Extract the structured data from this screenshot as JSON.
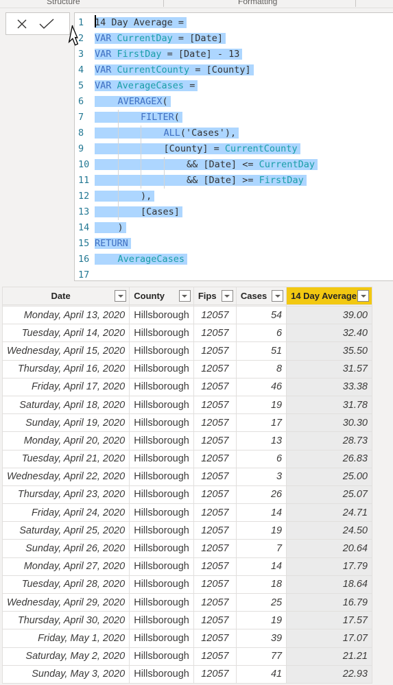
{
  "ribbon": {
    "groups": [
      "Structure",
      "Formatting"
    ]
  },
  "commit": {
    "cancel_icon": "close-icon",
    "commit_icon": "checkmark-icon"
  },
  "editor": {
    "lines": [
      {
        "n": "1",
        "indent": 0,
        "tokens": [
          {
            "t": "14 Day Average =",
            "c": "plain"
          }
        ]
      },
      {
        "n": "2",
        "indent": 0,
        "tokens": [
          {
            "t": "VAR ",
            "c": "kw"
          },
          {
            "t": "CurrentDay",
            "c": "var"
          },
          {
            "t": " = [Date]",
            "c": "plain"
          }
        ]
      },
      {
        "n": "3",
        "indent": 0,
        "tokens": [
          {
            "t": "VAR ",
            "c": "kw"
          },
          {
            "t": "FirstDay",
            "c": "var"
          },
          {
            "t": " = [Date] - 13",
            "c": "plain"
          }
        ]
      },
      {
        "n": "4",
        "indent": 0,
        "tokens": [
          {
            "t": "VAR ",
            "c": "kw"
          },
          {
            "t": "CurrentCounty",
            "c": "var"
          },
          {
            "t": " = [County]",
            "c": "plain"
          }
        ]
      },
      {
        "n": "5",
        "indent": 0,
        "tokens": [
          {
            "t": "VAR ",
            "c": "kw"
          },
          {
            "t": "AverageCases",
            "c": "var"
          },
          {
            "t": " =",
            "c": "plain"
          }
        ]
      },
      {
        "n": "6",
        "indent": 1,
        "tokens": [
          {
            "t": "AVERAGEX",
            "c": "kw"
          },
          {
            "t": "(",
            "c": "plain"
          }
        ]
      },
      {
        "n": "7",
        "indent": 2,
        "tokens": [
          {
            "t": "FILTER",
            "c": "kw"
          },
          {
            "t": "(",
            "c": "plain"
          }
        ]
      },
      {
        "n": "8",
        "indent": 3,
        "tokens": [
          {
            "t": "ALL",
            "c": "kw"
          },
          {
            "t": "('Cases'),",
            "c": "plain"
          }
        ]
      },
      {
        "n": "9",
        "indent": 3,
        "tokens": [
          {
            "t": "[County] = ",
            "c": "plain"
          },
          {
            "t": "CurrentCounty",
            "c": "var"
          }
        ]
      },
      {
        "n": "10",
        "indent": 4,
        "tokens": [
          {
            "t": "&& [Date] <= ",
            "c": "plain"
          },
          {
            "t": "CurrentDay",
            "c": "var"
          }
        ]
      },
      {
        "n": "11",
        "indent": 4,
        "tokens": [
          {
            "t": "&& [Date] >= ",
            "c": "plain"
          },
          {
            "t": "FirstDay",
            "c": "var"
          }
        ]
      },
      {
        "n": "12",
        "indent": 2,
        "tokens": [
          {
            "t": "),",
            "c": "plain"
          }
        ]
      },
      {
        "n": "13",
        "indent": 2,
        "tokens": [
          {
            "t": "[Cases]",
            "c": "plain"
          }
        ]
      },
      {
        "n": "14",
        "indent": 1,
        "tokens": [
          {
            "t": ")",
            "c": "plain"
          }
        ]
      },
      {
        "n": "15",
        "indent": 0,
        "tokens": [
          {
            "t": "RETURN",
            "c": "kw"
          }
        ]
      },
      {
        "n": "16",
        "indent": 1,
        "tokens": [
          {
            "t": "AverageCases",
            "c": "var"
          }
        ]
      },
      {
        "n": "17",
        "indent": 0,
        "tokens": []
      }
    ]
  },
  "table": {
    "columns": [
      {
        "label": "Date",
        "key": "date"
      },
      {
        "label": "County",
        "key": "county"
      },
      {
        "label": "Fips",
        "key": "fips"
      },
      {
        "label": "Cases",
        "key": "cases"
      },
      {
        "label": "14 Day Average",
        "key": "avg",
        "active": true
      }
    ],
    "active_color": "#F2C811",
    "rows": [
      {
        "date": "Monday, April 13, 2020",
        "county": "Hillsborough",
        "fips": "12057",
        "cases": "54",
        "avg": "39.00"
      },
      {
        "date": "Tuesday, April 14, 2020",
        "county": "Hillsborough",
        "fips": "12057",
        "cases": "6",
        "avg": "32.40"
      },
      {
        "date": "Wednesday, April 15, 2020",
        "county": "Hillsborough",
        "fips": "12057",
        "cases": "51",
        "avg": "35.50"
      },
      {
        "date": "Thursday, April 16, 2020",
        "county": "Hillsborough",
        "fips": "12057",
        "cases": "8",
        "avg": "31.57"
      },
      {
        "date": "Friday, April 17, 2020",
        "county": "Hillsborough",
        "fips": "12057",
        "cases": "46",
        "avg": "33.38"
      },
      {
        "date": "Saturday, April 18, 2020",
        "county": "Hillsborough",
        "fips": "12057",
        "cases": "19",
        "avg": "31.78"
      },
      {
        "date": "Sunday, April 19, 2020",
        "county": "Hillsborough",
        "fips": "12057",
        "cases": "17",
        "avg": "30.30"
      },
      {
        "date": "Monday, April 20, 2020",
        "county": "Hillsborough",
        "fips": "12057",
        "cases": "13",
        "avg": "28.73"
      },
      {
        "date": "Tuesday, April 21, 2020",
        "county": "Hillsborough",
        "fips": "12057",
        "cases": "6",
        "avg": "26.83"
      },
      {
        "date": "Wednesday, April 22, 2020",
        "county": "Hillsborough",
        "fips": "12057",
        "cases": "3",
        "avg": "25.00"
      },
      {
        "date": "Thursday, April 23, 2020",
        "county": "Hillsborough",
        "fips": "12057",
        "cases": "26",
        "avg": "25.07"
      },
      {
        "date": "Friday, April 24, 2020",
        "county": "Hillsborough",
        "fips": "12057",
        "cases": "14",
        "avg": "24.71"
      },
      {
        "date": "Saturday, April 25, 2020",
        "county": "Hillsborough",
        "fips": "12057",
        "cases": "19",
        "avg": "24.50"
      },
      {
        "date": "Sunday, April 26, 2020",
        "county": "Hillsborough",
        "fips": "12057",
        "cases": "7",
        "avg": "20.64"
      },
      {
        "date": "Monday, April 27, 2020",
        "county": "Hillsborough",
        "fips": "12057",
        "cases": "14",
        "avg": "17.79"
      },
      {
        "date": "Tuesday, April 28, 2020",
        "county": "Hillsborough",
        "fips": "12057",
        "cases": "18",
        "avg": "18.64"
      },
      {
        "date": "Wednesday, April 29, 2020",
        "county": "Hillsborough",
        "fips": "12057",
        "cases": "25",
        "avg": "16.79"
      },
      {
        "date": "Thursday, April 30, 2020",
        "county": "Hillsborough",
        "fips": "12057",
        "cases": "19",
        "avg": "17.57"
      },
      {
        "date": "Friday, May 1, 2020",
        "county": "Hillsborough",
        "fips": "12057",
        "cases": "39",
        "avg": "17.07"
      },
      {
        "date": "Saturday, May 2, 2020",
        "county": "Hillsborough",
        "fips": "12057",
        "cases": "77",
        "avg": "21.21"
      },
      {
        "date": "Sunday, May 3, 2020",
        "county": "Hillsborough",
        "fips": "12057",
        "cases": "41",
        "avg": "22.93"
      }
    ]
  }
}
